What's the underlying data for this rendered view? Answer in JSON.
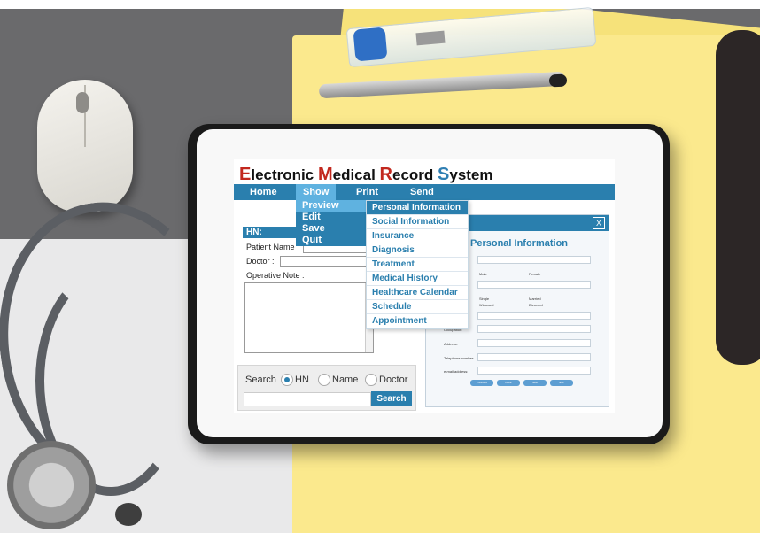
{
  "app": {
    "title_parts": [
      {
        "letter": "E",
        "rest": "lectronic "
      },
      {
        "letter": "M",
        "rest": "edical "
      },
      {
        "letter": "R",
        "rest": "ecord "
      },
      {
        "letter": "S",
        "rest": "ystem"
      }
    ]
  },
  "menu": {
    "items": [
      "Home",
      "Show",
      "Print",
      "Send"
    ],
    "active": "Show"
  },
  "show_dropdown": {
    "items": [
      "Preview",
      "Edit",
      "Save",
      "Quit"
    ],
    "highlighted": "Preview"
  },
  "preview_dropdown": {
    "items": [
      "Personal Information",
      "Social Information",
      "Insurance",
      "Diagnosis",
      "Treatment",
      "Medical History",
      "Healthcare Calendar",
      "Schedule",
      "Appointment"
    ],
    "highlighted": "Personal Information"
  },
  "patient_panel": {
    "hn_label": "HN:",
    "patient_name_label": "Patient Name",
    "doctor_label": "Doctor :",
    "operative_note_label": "Operative Note :"
  },
  "search": {
    "label": "Search",
    "options": [
      "HN",
      "Name",
      "Doctor"
    ],
    "selected": "HN",
    "button_label": "Search"
  },
  "personal_info_window": {
    "close_label": "X",
    "heading": "Personal Information",
    "options": {
      "male": "Male",
      "female": "Female",
      "single": "Single",
      "married": "Married",
      "widowed": "Widowed",
      "divorced": "Divorced"
    },
    "field_labels": [
      "Occupation:",
      "Address:",
      "Telephone number:",
      "e-mail address:"
    ],
    "buttons": [
      "Previous",
      "Done",
      "Next",
      "Exit"
    ]
  },
  "colors": {
    "accent_blue": "#2a7fae",
    "highlight_blue": "#5fb2e0",
    "title_red": "#c2281e"
  }
}
